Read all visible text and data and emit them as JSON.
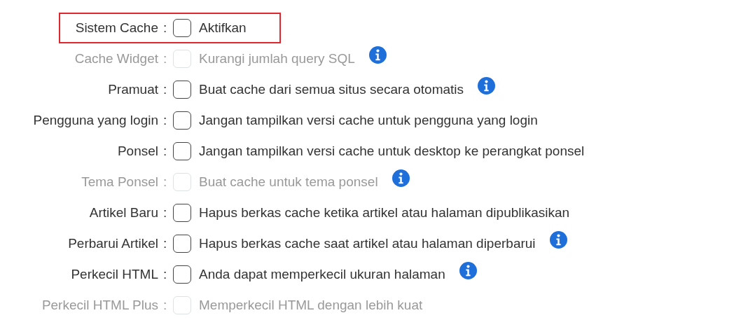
{
  "settings": [
    {
      "label": "Sistem Cache",
      "colon": ":",
      "checked": false,
      "disabled": false,
      "description": "Aktifkan",
      "info": false,
      "highlighted": true
    },
    {
      "label": "Cache Widget",
      "colon": ":",
      "checked": false,
      "disabled": true,
      "description": "Kurangi jumlah query SQL",
      "info": true,
      "highlighted": false
    },
    {
      "label": "Pramuat",
      "colon": ":",
      "checked": false,
      "disabled": false,
      "description": "Buat cache dari semua situs secara otomatis",
      "info": true,
      "highlighted": false
    },
    {
      "label": "Pengguna yang login",
      "colon": ":",
      "checked": false,
      "disabled": false,
      "description": "Jangan tampilkan versi cache untuk pengguna yang login",
      "info": false,
      "highlighted": false
    },
    {
      "label": "Ponsel",
      "colon": ":",
      "checked": false,
      "disabled": false,
      "description": "Jangan tampilkan versi cache untuk desktop ke perangkat ponsel",
      "info": false,
      "highlighted": false
    },
    {
      "label": "Tema Ponsel",
      "colon": ":",
      "checked": false,
      "disabled": true,
      "description": "Buat cache untuk tema ponsel",
      "info": true,
      "highlighted": false
    },
    {
      "label": "Artikel Baru",
      "colon": ":",
      "checked": false,
      "disabled": false,
      "description": "Hapus berkas cache ketika artikel atau halaman dipublikasikan",
      "info": false,
      "highlighted": false
    },
    {
      "label": "Perbarui Artikel",
      "colon": ":",
      "checked": false,
      "disabled": false,
      "description": "Hapus berkas cache saat artikel atau halaman diperbarui",
      "info": true,
      "highlighted": false
    },
    {
      "label": "Perkecil HTML",
      "colon": ":",
      "checked": false,
      "disabled": false,
      "description": "Anda dapat memperkecil ukuran halaman",
      "info": true,
      "highlighted": false
    },
    {
      "label": "Perkecil HTML Plus",
      "colon": ":",
      "checked": false,
      "disabled": true,
      "description": "Memperkecil HTML dengan lebih kuat",
      "info": false,
      "highlighted": false
    }
  ]
}
